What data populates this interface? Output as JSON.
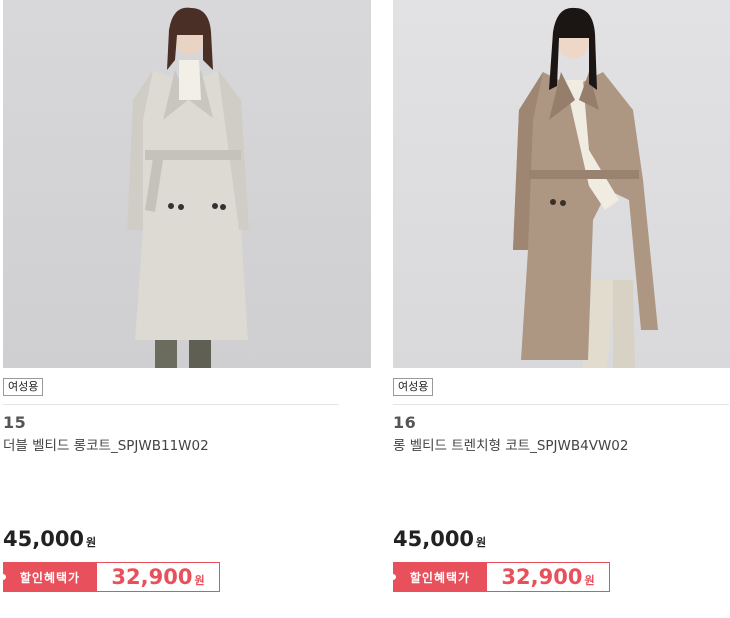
{
  "products": [
    {
      "tag": "여성용",
      "number": "15",
      "name": "더블 벨티드 롱코트_SPJWB11W02",
      "price": "45,000",
      "won": "원",
      "sale_label": "할인혜택가",
      "sale_price": "32,900",
      "sale_won": "원",
      "coat_color": "#d8d6cf"
    },
    {
      "tag": "여성용",
      "number": "16",
      "name": "롱 벨티드 트렌치형 코트_SPJWB4VW02",
      "price": "45,000",
      "won": "원",
      "sale_label": "할인혜택가",
      "sale_price": "32,900",
      "sale_won": "원",
      "coat_color": "#a9937f"
    }
  ],
  "colors": {
    "accent": "#e8505b"
  }
}
